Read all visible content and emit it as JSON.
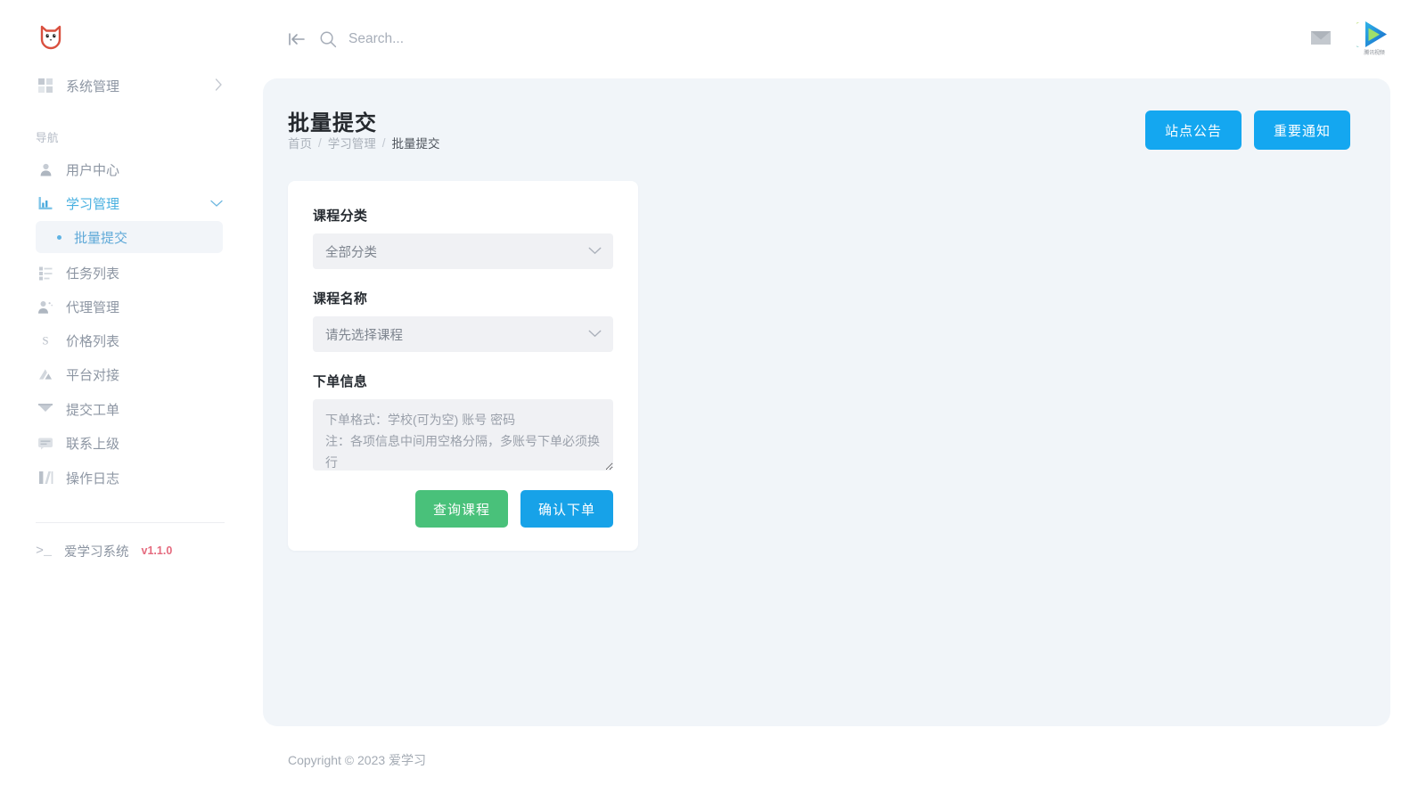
{
  "brand": {
    "logo_icon": "cat-face-logo",
    "accent_blue": "#14a7f0",
    "accent_green": "#49c17a",
    "logo_red": "#d9503f"
  },
  "sidebar": {
    "top_item": {
      "label": "系统管理",
      "icon": "grid-icon",
      "chevron": "chevron-right-icon"
    },
    "section_label": "导航",
    "items": [
      {
        "label": "用户中心",
        "icon": "user-icon"
      },
      {
        "label": "学习管理",
        "icon": "chart-icon",
        "chevron": "chevron-down-icon",
        "active": true
      },
      {
        "label": "批量提交",
        "icon": "bullet-dot",
        "sub": true,
        "active": true
      },
      {
        "label": "任务列表",
        "icon": "task-list-icon"
      },
      {
        "label": "代理管理",
        "icon": "agent-icon"
      },
      {
        "label": "价格列表",
        "icon": "s-currency-icon"
      },
      {
        "label": "平台对接",
        "icon": "platform-icon"
      },
      {
        "label": "提交工单",
        "icon": "ticket-icon"
      },
      {
        "label": "联系上级",
        "icon": "message-icon"
      },
      {
        "label": "操作日志",
        "icon": "log-icon"
      }
    ],
    "footer": {
      "terminal_icon": "terminal-icon",
      "system_name": "爱学习系统",
      "version": "v1.1.0"
    }
  },
  "topbar": {
    "collapse_icon": "collapse-sidebar-icon",
    "search_icon": "search-icon",
    "search_value": "",
    "search_placeholder": "Search...",
    "mail_icon": "mail-icon",
    "logo_icon": "tencent-video-logo",
    "logo_caption": "腾讯视频"
  },
  "main": {
    "page_title": "批量提交",
    "breadcrumb": [
      {
        "label": "首页"
      },
      {
        "label": "学习管理"
      },
      {
        "label": "批量提交"
      }
    ],
    "breadcrumb_separator": "/",
    "header_buttons": [
      {
        "label": "站点公告"
      },
      {
        "label": "重要通知"
      }
    ],
    "form": {
      "category": {
        "label": "课程分类",
        "value": "全部分类",
        "chevron": "chevron-down-icon"
      },
      "course": {
        "label": "课程名称",
        "value": "请先选择课程",
        "chevron": "chevron-down-icon"
      },
      "order": {
        "label": "下单信息",
        "value": "",
        "placeholder": "下单格式：学校(可为空) 账号 密码\n注：各项信息中间用空格分隔，多账号下单必须换行"
      },
      "buttons": {
        "query": "查询课程",
        "confirm": "确认下单"
      }
    }
  },
  "footer": {
    "copyright": "Copyright © 2023 爱学习"
  }
}
